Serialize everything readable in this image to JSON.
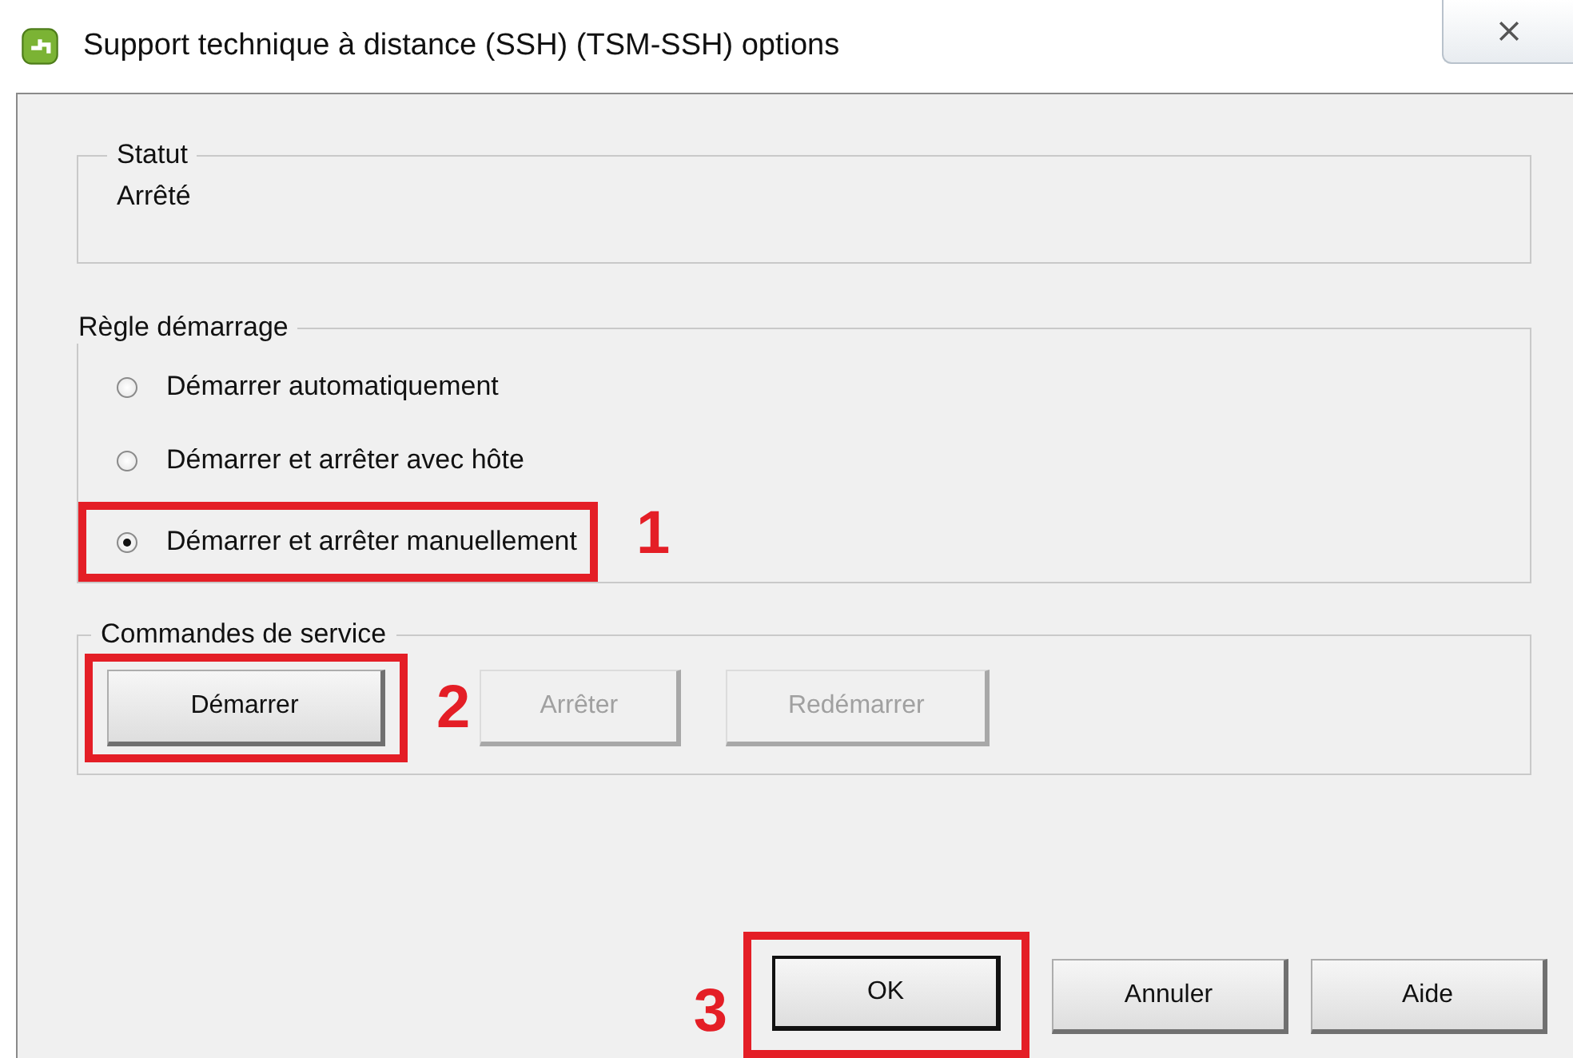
{
  "window": {
    "title": "Support technique à distance (SSH) (TSM-SSH) options"
  },
  "status": {
    "legend": "Statut",
    "value": "Arrêté"
  },
  "startup_policy": {
    "legend": "Règle démarrage",
    "options": [
      {
        "label": "Démarrer automatiquement",
        "selected": false
      },
      {
        "label": "Démarrer et arrêter avec hôte",
        "selected": false
      },
      {
        "label": "Démarrer et arrêter manuellement",
        "selected": true,
        "callout": "1"
      }
    ]
  },
  "service_commands": {
    "legend": "Commandes de service",
    "buttons": [
      {
        "label": "Démarrer",
        "disabled": false,
        "callout": "2"
      },
      {
        "label": "Arrêter",
        "disabled": true
      },
      {
        "label": "Redémarrer",
        "disabled": true
      }
    ]
  },
  "buttons": [
    {
      "label": "OK",
      "default": true,
      "callout": "3"
    },
    {
      "label": "Annuler",
      "default": false
    },
    {
      "label": "Aide",
      "default": false
    }
  ]
}
